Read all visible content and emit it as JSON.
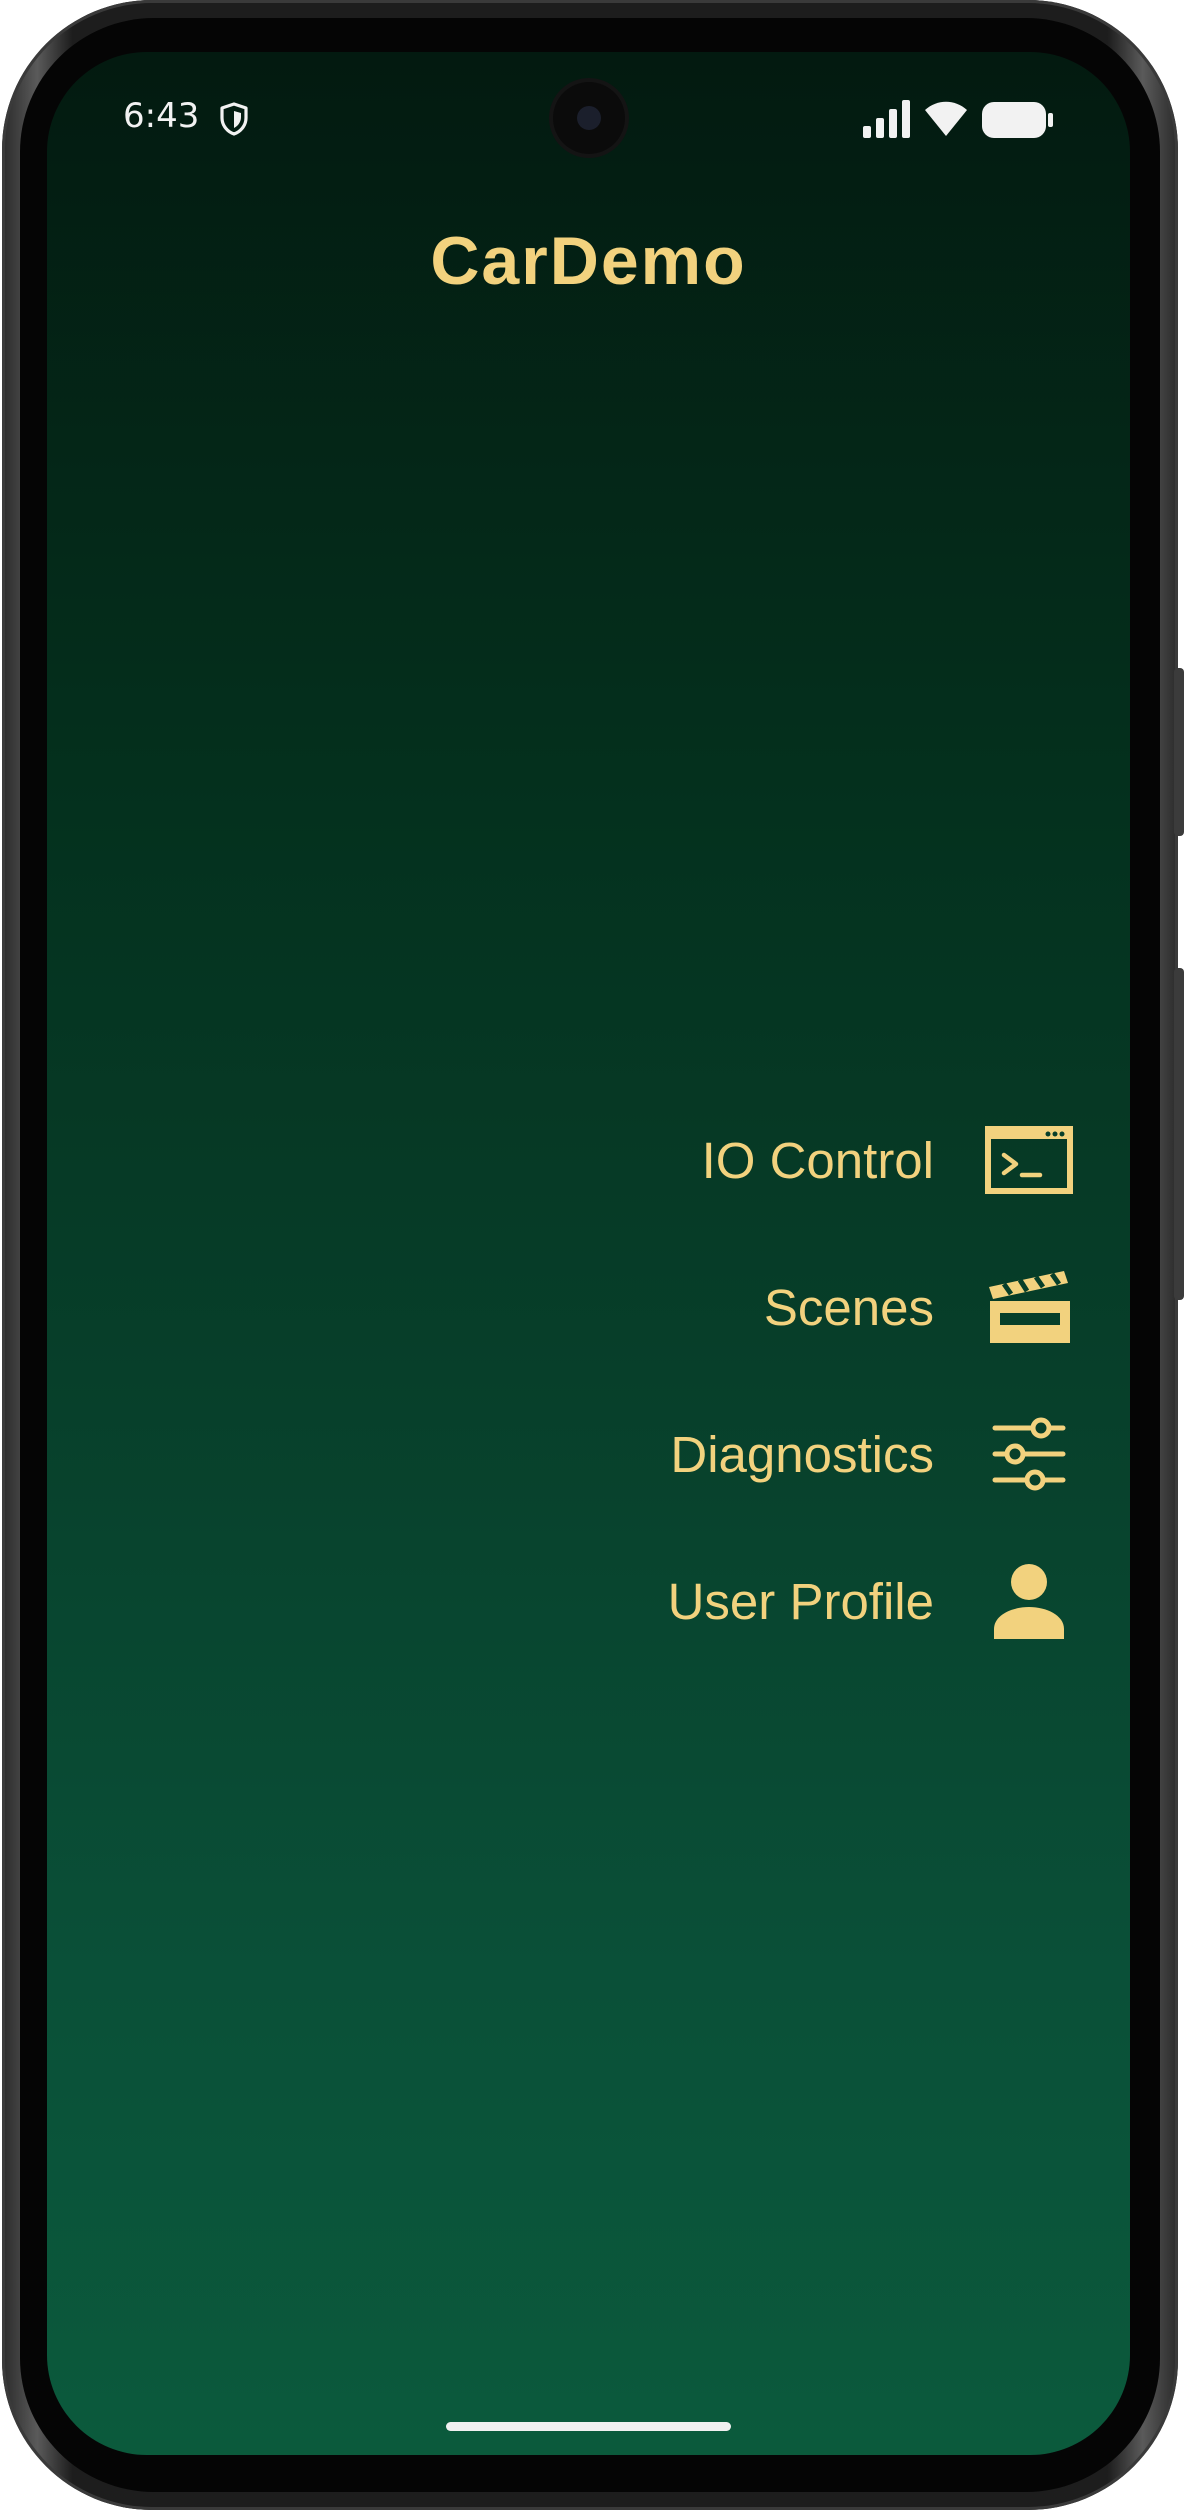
{
  "status_bar": {
    "time": "6:43",
    "icons": [
      "shield-icon",
      "signal-icon",
      "wifi-icon",
      "battery-icon"
    ]
  },
  "app": {
    "title": "CarDemo"
  },
  "menu": {
    "items": [
      {
        "label": "IO Control",
        "icon": "terminal-window-icon"
      },
      {
        "label": "Scenes",
        "icon": "clapperboard-icon"
      },
      {
        "label": "Diagnostics",
        "icon": "sliders-icon"
      },
      {
        "label": "User Profile",
        "icon": "person-icon"
      }
    ]
  },
  "colors": {
    "accent": "#f2d27e",
    "background_top": "#031a10",
    "background_bottom": "#0b5a3c"
  }
}
